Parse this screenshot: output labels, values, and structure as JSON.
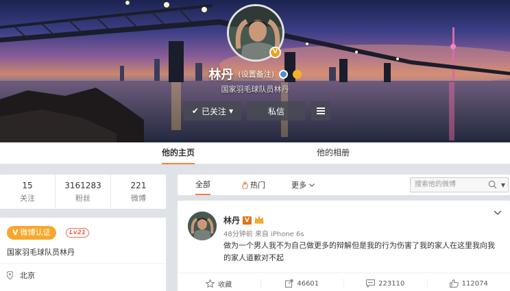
{
  "profile": {
    "name": "林丹",
    "remark_link": "(设置备注)",
    "bio": "国家羽毛球队员林丹",
    "follow_label": "已关注",
    "message_label": "私信"
  },
  "tabs": [
    "他的主页",
    "他的相册"
  ],
  "stats": [
    {
      "num": "15",
      "label": "关注"
    },
    {
      "num": "3161283",
      "label": "粉丝"
    },
    {
      "num": "221",
      "label": "微博"
    }
  ],
  "info": {
    "verify_label": "微博认证",
    "level": "Lv21",
    "description": "国家羽毛球队员林丹",
    "location": "北京"
  },
  "feed_tabs": {
    "all": "全部",
    "hot": "热门",
    "more": "更多"
  },
  "search": {
    "placeholder": "搜索他的微博"
  },
  "post": {
    "author": "林丹",
    "meta": "48分钟前 来自 iPhone 6s",
    "text": "做为一个男人我不为自己做更多的辩解但是我的行为伤害了我的家人在这里我向我的家人道歉对不起",
    "favorite_label": "收藏",
    "reposts": "46601",
    "comments": "223110",
    "likes": "112074"
  },
  "colors": {
    "accent": "#fa7d3c",
    "verify": "#f7a82b",
    "level": "#f06a5a"
  }
}
